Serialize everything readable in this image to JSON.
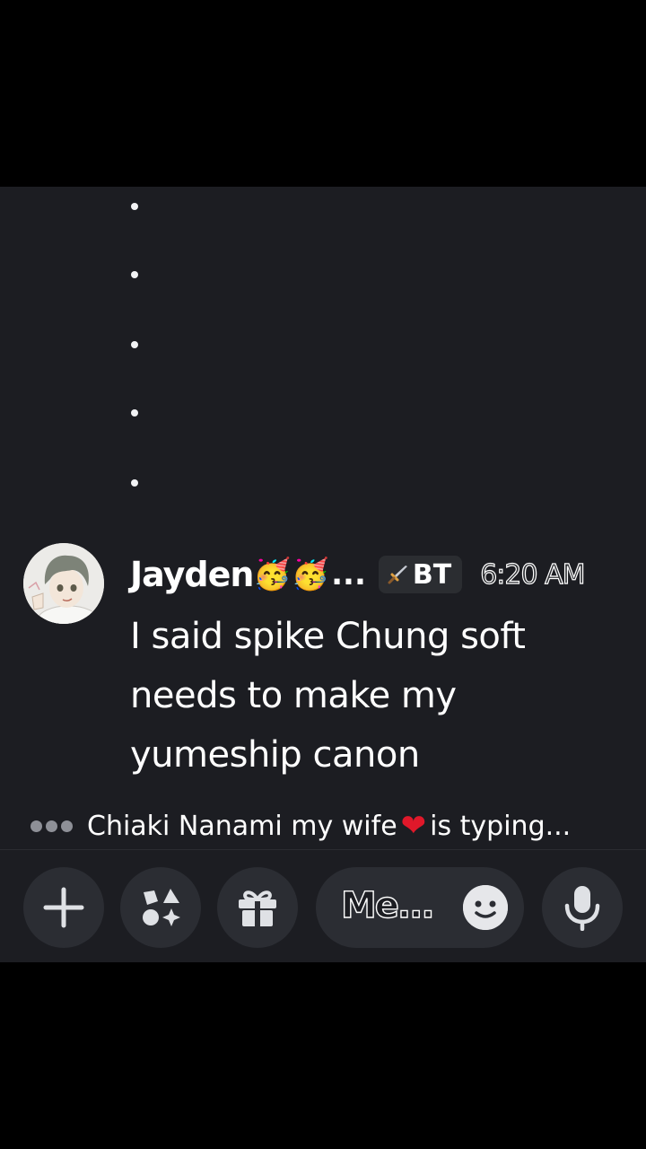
{
  "message": {
    "username": "Jayden",
    "username_emojis": [
      "🥳",
      "🥳"
    ],
    "username_ellipsis": "...",
    "tag_icon": "sword-icon",
    "tag_label": "BT",
    "timestamp": "6:20 AM",
    "text": "I said spike Chung soft needs to make my yumeship canon"
  },
  "typing": {
    "text_before": "Chiaki Nanami my wife",
    "heart": "❤",
    "text_after": "is typing..."
  },
  "composer": {
    "placeholder": "Me...",
    "buttons": [
      "plus-icon",
      "apps-icon",
      "gift-icon",
      "emoji-icon",
      "microphone-icon"
    ]
  },
  "colors": {
    "background": "#1c1d22",
    "button": "#2b2d33",
    "heart": "#e0182a"
  }
}
